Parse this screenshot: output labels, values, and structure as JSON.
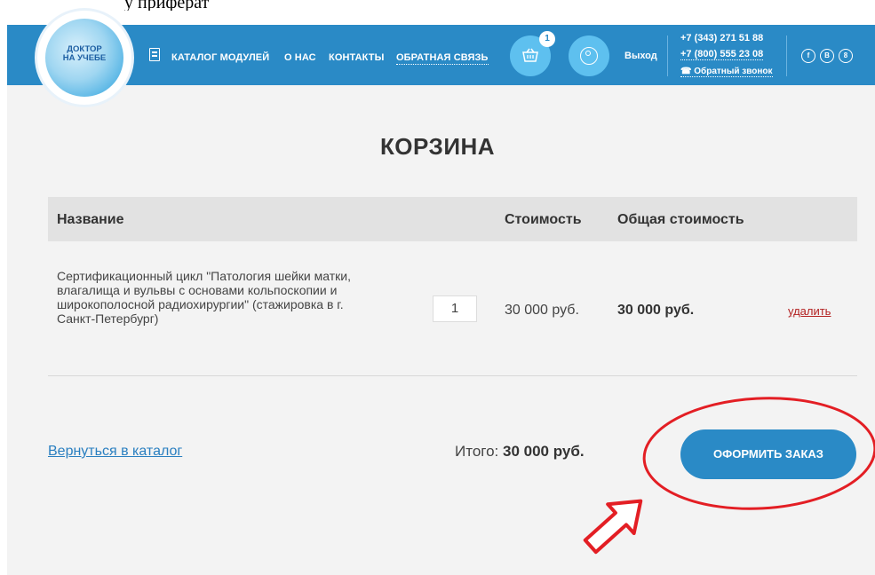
{
  "logo": {
    "text_line1": "ДОКТОР",
    "text_line2": "НА УЧЕБЕ"
  },
  "nav": {
    "catalog": "КАТАЛОГ МОДУЛЕЙ",
    "about": "О НАС",
    "contacts": "КОНТАКТЫ",
    "feedback": "ОБРАТНАЯ СВЯЗЬ"
  },
  "cart": {
    "badge_count": "1",
    "icon": "basket-icon"
  },
  "user": {
    "icon": "user-icon",
    "logout": "Выход"
  },
  "contacts": {
    "phone1": "+7 (343) 271 51 88",
    "phone2": "+7 (800) 555 23 08",
    "callback": "Обратный звонок"
  },
  "social": {
    "facebook": "f",
    "vk": "В",
    "odnoklassniki": "8"
  },
  "page": {
    "title": "КОРЗИНА"
  },
  "table": {
    "headers": {
      "name": "Название",
      "price": "Стоимость",
      "total": "Общая стоимость"
    },
    "rows": [
      {
        "name": "Сертификационный цикл \"Патология шейки матки, влагалища и вульвы с основами кольпоскопии и широкополосной радиохирургии\" (стажировка в г. Санкт-Петербург)",
        "quantity": "1",
        "price": "30 000 руб.",
        "total": "30 000 руб.",
        "remove": "удалить"
      }
    ]
  },
  "footer": {
    "back_link": "Вернуться в каталог",
    "total_label": "Итого:",
    "total_value": "30 000 руб.",
    "order_button": "ОФОРМИТЬ ЗАКАЗ"
  },
  "colors": {
    "header": "#2a8ac6",
    "accent": "#5ec0ef",
    "annotation": "#e31e24"
  }
}
